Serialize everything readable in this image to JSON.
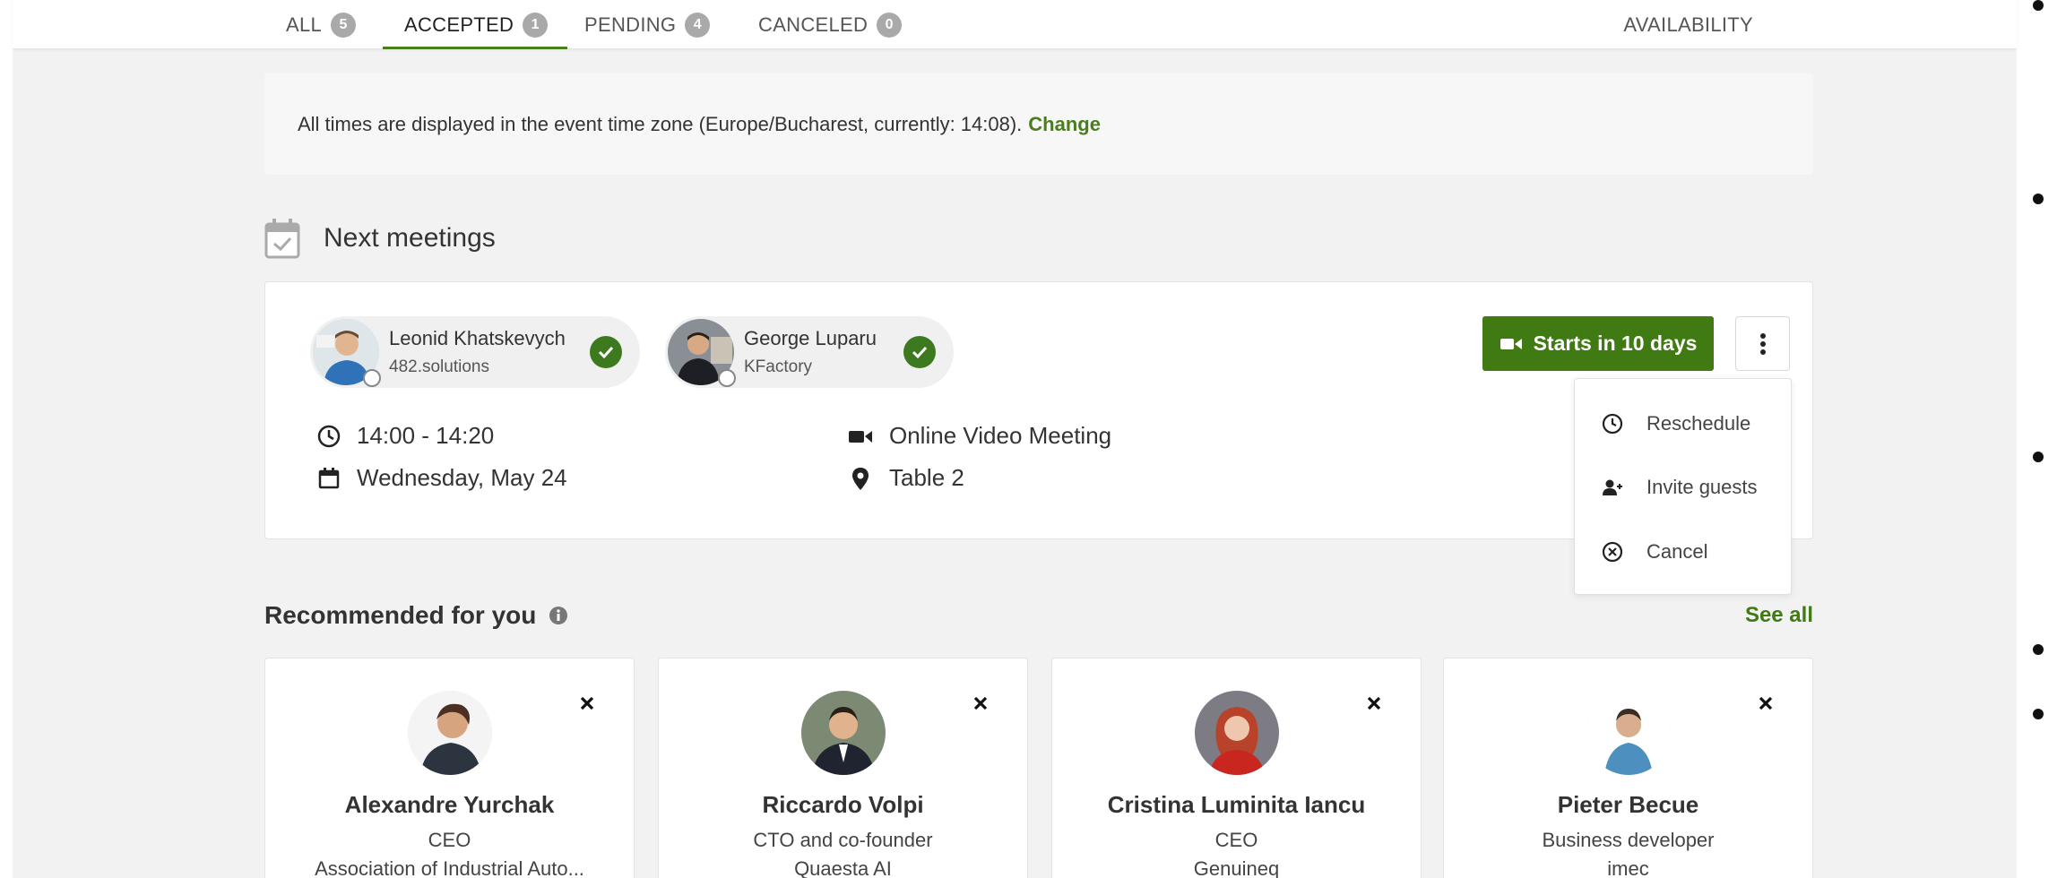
{
  "tabs": [
    {
      "label": "ALL",
      "count": "5"
    },
    {
      "label": "ACCEPTED",
      "count": "1"
    },
    {
      "label": "PENDING",
      "count": "4"
    },
    {
      "label": "CANCELED",
      "count": "0"
    }
  ],
  "active_tab": "ACCEPTED",
  "availability_label": "AVAILABILITY",
  "notice": {
    "text": "All times are displayed in the event time zone (Europe/Bucharest, currently: 14:08).",
    "link": "Change"
  },
  "next_meetings": {
    "title": "Next meetings",
    "participants": [
      {
        "name": "Leonid Khatskevych",
        "company": "482.solutions"
      },
      {
        "name": "George Luparu",
        "company": "KFactory"
      }
    ],
    "time": "14:00 - 14:20",
    "date": "Wednesday, May 24",
    "type": "Online Video Meeting",
    "location": "Table 2",
    "starts_label": "Starts in 10 days"
  },
  "menu": {
    "items": [
      {
        "label": "Reschedule",
        "icon": "clock-icon"
      },
      {
        "label": "Invite guests",
        "icon": "user-plus-icon"
      },
      {
        "label": "Cancel",
        "icon": "x-circle-icon"
      }
    ]
  },
  "recommended": {
    "title": "Recommended for you",
    "see_all": "See all",
    "people": [
      {
        "name": "Alexandre Yurchak",
        "role": "CEO",
        "org": "Association of Industrial Auto..."
      },
      {
        "name": "Riccardo Volpi",
        "role": "CTO and co-founder",
        "org": "Quaesta AI"
      },
      {
        "name": "Cristina Luminita Iancu",
        "role": "CEO",
        "org": "Genuineq"
      },
      {
        "name": "Pieter Becue",
        "role": "Business developer",
        "org": "imec"
      }
    ]
  },
  "colors": {
    "accent": "#3f7a12",
    "badge": "#a9a9a9",
    "background": "#f2f2f2"
  }
}
